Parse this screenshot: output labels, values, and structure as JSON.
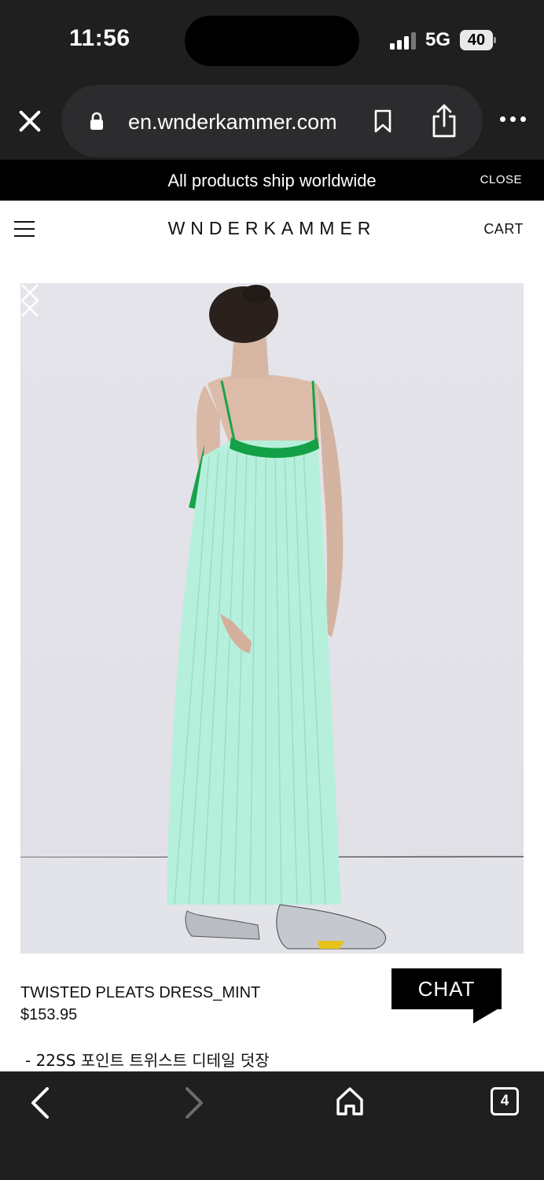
{
  "status_bar": {
    "time": "11:56",
    "network": "5G",
    "battery": "40"
  },
  "browser": {
    "url": "en.wnderkammer.com",
    "tab_count": "4"
  },
  "announcement": {
    "text": "All products ship worldwide",
    "close_label": "CLOSE"
  },
  "header": {
    "brand": "WNDERKAMMER",
    "cart_label": "CART"
  },
  "product": {
    "name": "TWISTED PLEATS DRESS_MINT",
    "price": "$153.95",
    "description": "- 22SS 포인트 트위스트 디테일 덧장"
  },
  "chat": {
    "label": "CHAT"
  },
  "colors": {
    "dress_mint": "#b6f0dc",
    "trim_green": "#1aa34a",
    "photo_bg": "#e2e2e8"
  }
}
